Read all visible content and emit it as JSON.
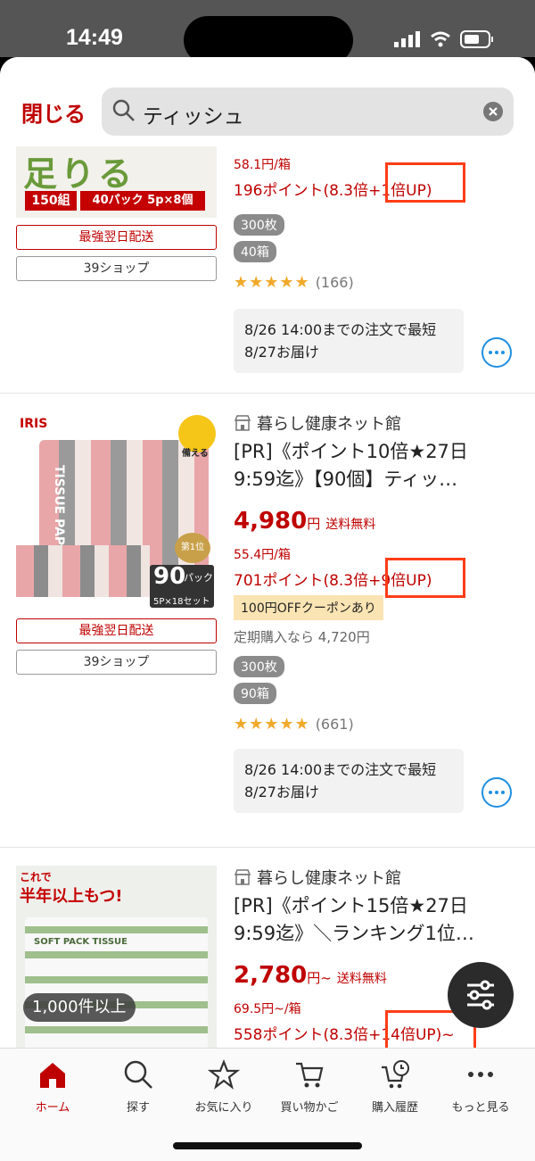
{
  "status": {
    "time": "14:49"
  },
  "header": {
    "close_label": "閉じる",
    "search_query": "ティッシュ"
  },
  "products": [
    {
      "img_text": [
        "足りる",
        "150組",
        "40パック 5p×8個"
      ],
      "badge_delivery": "最強翌日配送",
      "badge_shop": "39ショップ",
      "unit_price": "58.1円/箱",
      "points": "196ポイント(8.3倍+1倍UP)",
      "chips": [
        "300枚",
        "40箱"
      ],
      "rating_stars": "★★★★★",
      "rating_count": "(166)",
      "delivery": "8/26 14:00までの注文で最短8/27お届け"
    },
    {
      "shop": "暮らし健康ネット館",
      "title": "[PR]《ポイント10倍★27日9:59迄》【90個】ティッ…",
      "price": "4,980",
      "price_suffix": "円",
      "shipping": "送料無料",
      "unit_price": "55.4円/箱",
      "points": "701ポイント(8.3倍+9倍UP)",
      "coupon": "100円OFFクーポンあり",
      "regular": "定期購入なら 4,720円",
      "chips": [
        "300枚",
        "90箱"
      ],
      "rating_stars": "★★★★★",
      "rating_count": "(661)",
      "delivery": "8/26 14:00までの注文で最短8/27お届け",
      "img_text": [
        "IRIS",
        "TISSUE PAPER",
        "90",
        "パック",
        "5P×18セット",
        "備える",
        "第1位"
      ],
      "badge_delivery": "最強翌日配送",
      "badge_shop": "39ショップ"
    },
    {
      "shop": "暮らし健康ネット館",
      "title": "[PR]《ポイント15倍★27日9:59迄》＼ランキング1位…",
      "price": "2,780",
      "price_suffix": "円~",
      "shipping": "送料無料",
      "unit_price": "69.5円~/箱",
      "points": "558ポイント(8.3倍+14倍UP)~",
      "img_text": [
        "これで",
        "半年以上もつ!",
        "1,000件以上",
        "SOFT PACK TISSUE"
      ]
    }
  ],
  "tabbar": [
    {
      "label": "ホーム",
      "icon": "home-icon"
    },
    {
      "label": "探す",
      "icon": "search-icon"
    },
    {
      "label": "お気に入り",
      "icon": "star-icon"
    },
    {
      "label": "買い物かご",
      "icon": "cart-icon"
    },
    {
      "label": "購入履歴",
      "icon": "history-icon"
    },
    {
      "label": "もっと見る",
      "icon": "more-icon"
    }
  ],
  "colors": {
    "accent": "#bf0000",
    "highlight": "#ff3d17",
    "link": "#1f8fe0"
  }
}
